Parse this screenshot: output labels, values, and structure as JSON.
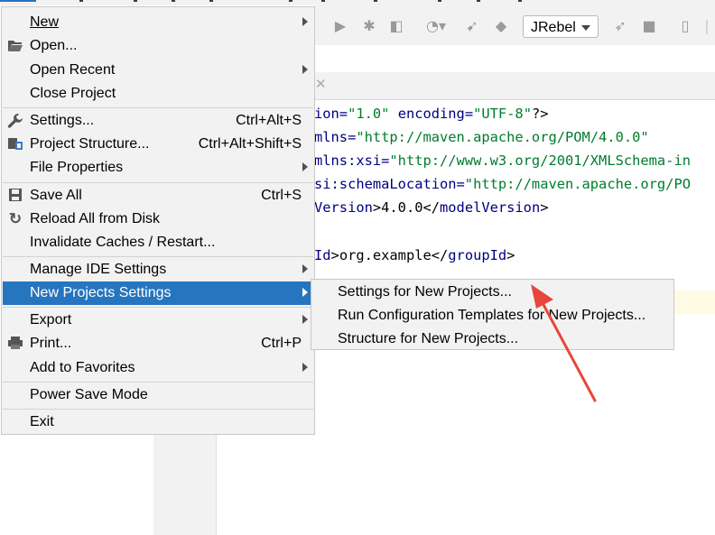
{
  "toolbar": {
    "run_config": "JRebel",
    "icons": [
      "run-icon",
      "debug-icon",
      "coverage-icon",
      "profile-icon",
      "build-icon",
      "jrebel-run-icon",
      "jrebel-debug-icon",
      "stop-icon",
      "device-icon"
    ]
  },
  "editor": {
    "lines": [
      {
        "k": "ion=",
        "v": "\"1.0\"",
        "k2": " encoding=",
        "v2": "\"UTF-8\"",
        "b": "?>"
      },
      {
        "k": "mlns=",
        "v": "\"http://maven.apache.org/POM/4.0.0\""
      },
      {
        "k": "mlns:xsi=",
        "v": "\"http://www.w3.org/2001/XMLSchema-in"
      },
      {
        "k": "si:schemaLocation=",
        "v": "\"http://maven.apache.org/PO"
      },
      {
        "k": "Version",
        "b": ">4.0.0</",
        "k2": "modelVersion",
        "b2": ">"
      },
      {
        "k": "Id",
        "b": ">org.example</",
        "k2": "groupId",
        "b2": ">"
      }
    ]
  },
  "file_menu": {
    "items": [
      {
        "label": "New",
        "mnemonic": "N"
      },
      {
        "label": "Open...",
        "mnemonic": "O"
      },
      {
        "label": "Open Recent"
      },
      {
        "label": "Close Project"
      },
      {
        "label": "Settings...",
        "shortcut": "Ctrl+Alt+S"
      },
      {
        "label": "Project Structure...",
        "shortcut": "Ctrl+Alt+Shift+S"
      },
      {
        "label": "File Properties"
      },
      {
        "label": "Save All",
        "shortcut": "Ctrl+S"
      },
      {
        "label": "Reload All from Disk"
      },
      {
        "label": "Invalidate Caches / Restart..."
      },
      {
        "label": "Manage IDE Settings"
      },
      {
        "label": "New Projects Settings"
      },
      {
        "label": "Export"
      },
      {
        "label": "Print...",
        "shortcut": "Ctrl+P"
      },
      {
        "label": "Add to Favorites"
      },
      {
        "label": "Power Save Mode"
      },
      {
        "label": "Exit"
      }
    ]
  },
  "submenu": {
    "items": [
      {
        "label": "Settings for New Projects..."
      },
      {
        "label": "Run Configuration Templates for New Projects..."
      },
      {
        "label": "Structure for New Projects..."
      }
    ]
  },
  "colors": {
    "selection": "#2675bf",
    "menu_bg": "#f2f2f2",
    "xml_tag": "#000080",
    "xml_value": "#007c2d",
    "annotation_arrow": "#e8463c"
  }
}
